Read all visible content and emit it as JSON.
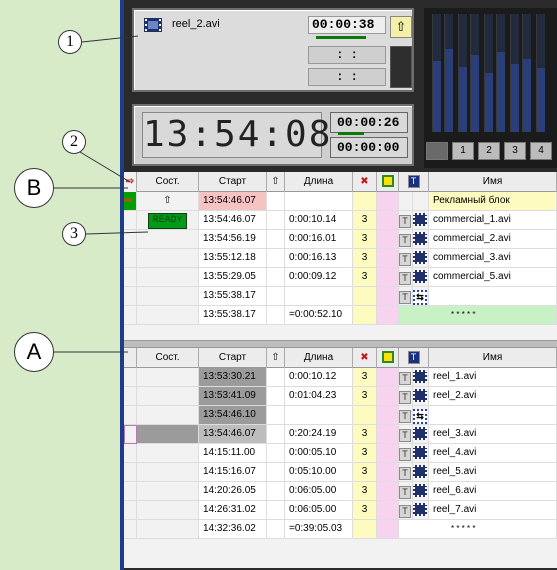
{
  "callouts": {
    "one": "1",
    "two": "2",
    "three": "3",
    "b": "B",
    "a": "A"
  },
  "clip": {
    "name": "reel_2.avi",
    "time": "00:00:38",
    "blank1": ":    :",
    "blank2": ":    :"
  },
  "clock": {
    "main": "13:54:08",
    "remaining": "00:00:26",
    "elapsed": "00:00:00"
  },
  "channels": [
    "",
    "1",
    "2",
    "3",
    "4"
  ],
  "headers": {
    "state": "Сост.",
    "start": "Старт",
    "length": "Длина",
    "name": "Имя",
    "t": "T"
  },
  "table_b": [
    {
      "state": "",
      "start": "13:54:46.07",
      "length": "",
      "num": "",
      "name": "Рекламный блок"
    },
    {
      "state": "READY",
      "start": "13:54:46.07",
      "length": "0:00:10.14",
      "num": "3",
      "name": "commercial_1.avi"
    },
    {
      "state": "",
      "start": "13:54:56.19",
      "length": "0:00:16.01",
      "num": "3",
      "name": "commercial_2.avi"
    },
    {
      "state": "",
      "start": "13:55:12.18",
      "length": "0:00:16.13",
      "num": "3",
      "name": "commercial_3.avi"
    },
    {
      "state": "",
      "start": "13:55:29.05",
      "length": "0:00:09.12",
      "num": "3",
      "name": "commercial_5.avi"
    },
    {
      "state": "",
      "start": "13:55:38.17",
      "length": "",
      "num": "",
      "name": ""
    },
    {
      "state": "",
      "start": "13:55:38.17",
      "length": "=0:00:52.10",
      "num": "",
      "name": "* * * * *"
    }
  ],
  "table_a": [
    {
      "start": "13:53:30.21",
      "length": "0:00:10.12",
      "num": "3",
      "name": "reel_1.avi"
    },
    {
      "start": "13:53:41.09",
      "length": "0:01:04.23",
      "num": "3",
      "name": "reel_2.avi"
    },
    {
      "start": "13:54:46.10",
      "length": "",
      "num": "",
      "name": ""
    },
    {
      "start": "13:54:46.07",
      "length": "0:20:24.19",
      "num": "3",
      "name": "reel_3.avi"
    },
    {
      "start": "14:15:11.00",
      "length": "0:00:05.10",
      "num": "3",
      "name": "reel_4.avi"
    },
    {
      "start": "14:15:16.07",
      "length": "0:05:10.00",
      "num": "3",
      "name": "reel_5.avi"
    },
    {
      "start": "14:20:26.05",
      "length": "0:06:05.00",
      "num": "3",
      "name": "reel_6.avi"
    },
    {
      "start": "14:26:31.02",
      "length": "0:06:05.00",
      "num": "3",
      "name": "reel_7.avi"
    },
    {
      "start": "14:32:36.02",
      "length": "=0:39:05.03",
      "num": "",
      "name": "* * * * *"
    }
  ],
  "colors": {
    "accent_green": "#009a1a",
    "border_blue": "#1d3c8a",
    "pink": "#f7d3ef",
    "yellow": "#fdfbc0"
  }
}
